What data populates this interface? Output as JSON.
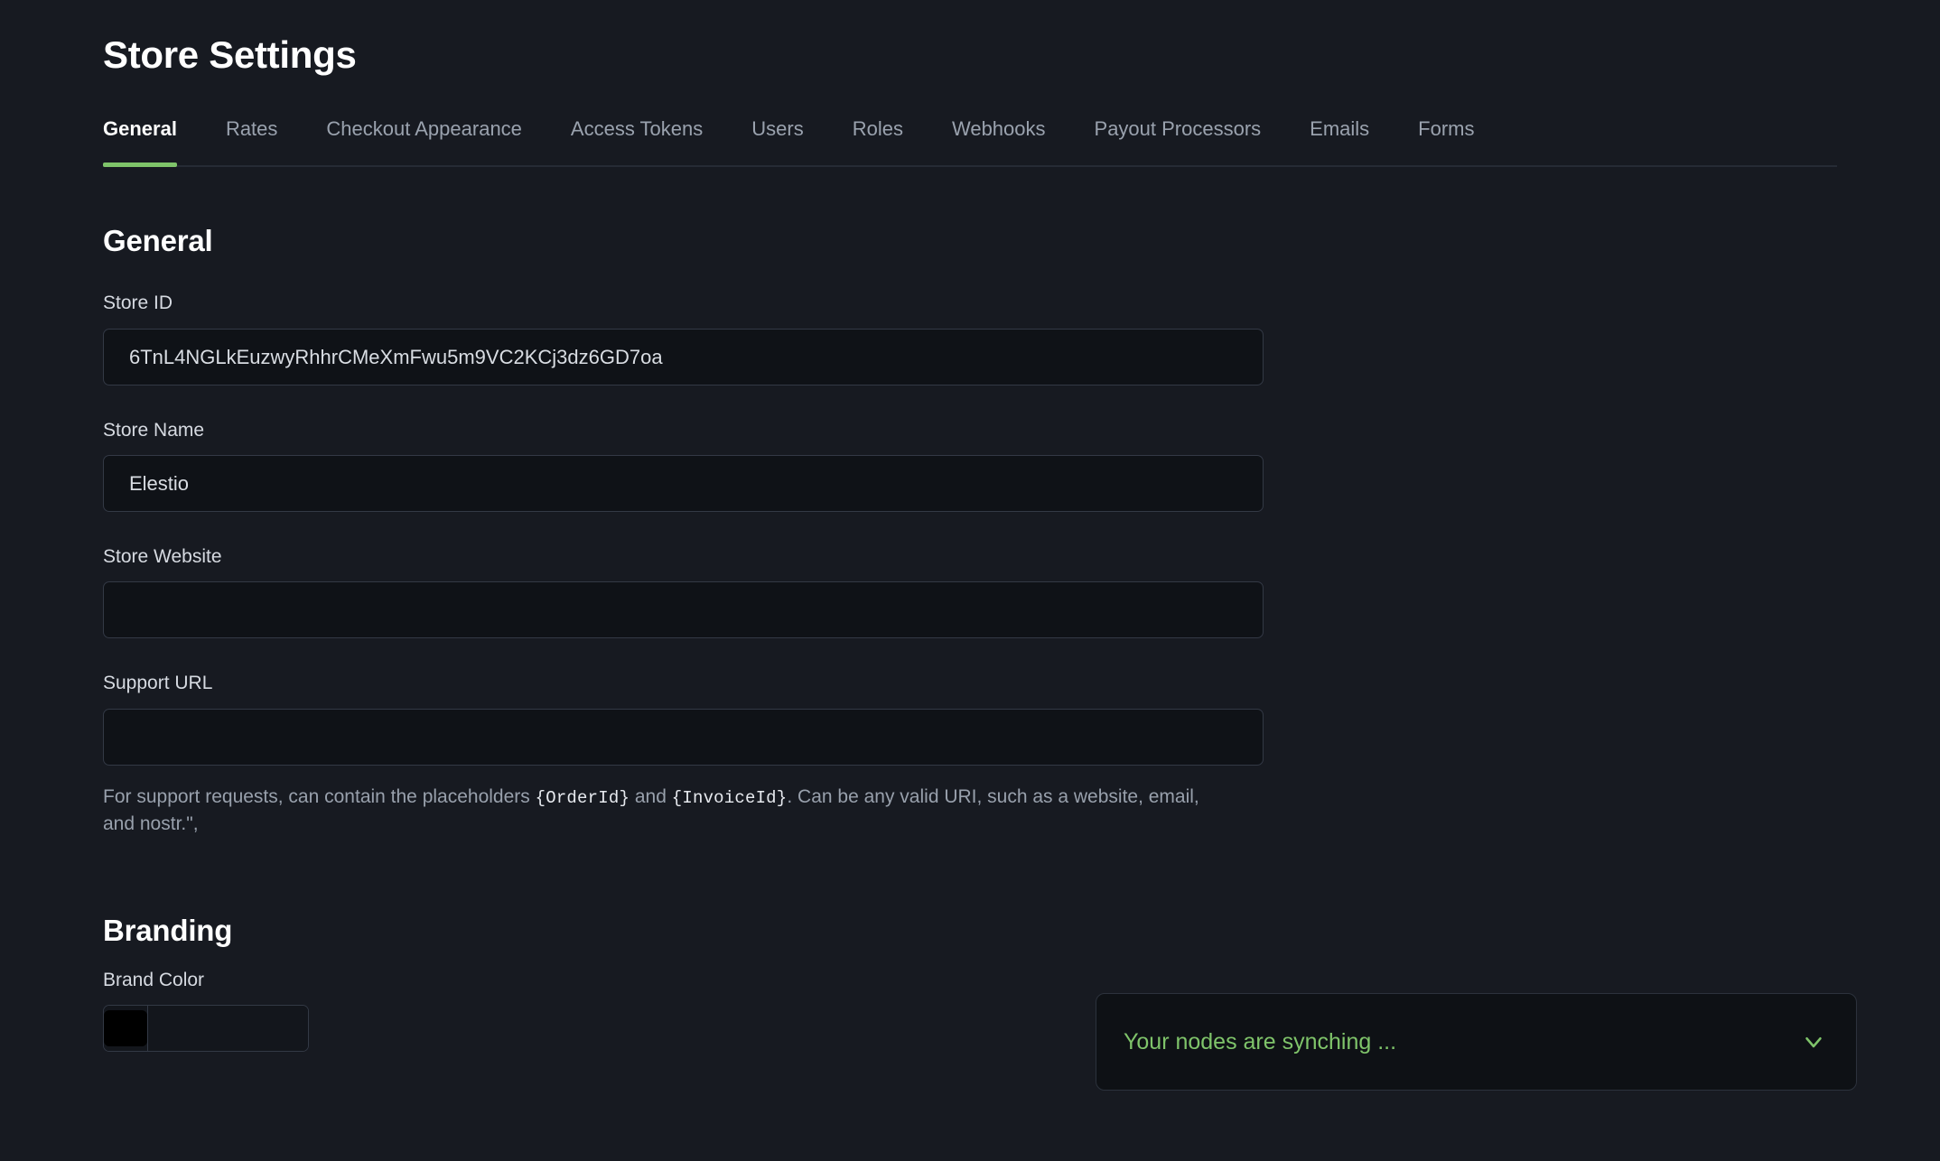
{
  "page": {
    "title": "Store Settings",
    "background_color": "#171a21",
    "accent_color": "#7fc46a"
  },
  "tabs": [
    {
      "label": "General",
      "active": true
    },
    {
      "label": "Rates",
      "active": false
    },
    {
      "label": "Checkout Appearance",
      "active": false
    },
    {
      "label": "Access Tokens",
      "active": false
    },
    {
      "label": "Users",
      "active": false
    },
    {
      "label": "Roles",
      "active": false
    },
    {
      "label": "Webhooks",
      "active": false
    },
    {
      "label": "Payout Processors",
      "active": false
    },
    {
      "label": "Emails",
      "active": false
    },
    {
      "label": "Forms",
      "active": false
    }
  ],
  "general": {
    "heading": "General",
    "store_id": {
      "label": "Store ID",
      "value": "6TnL4NGLkEuzwyRhhrCMeXmFwu5m9VC2KCj3dz6GD7oa",
      "placeholder": ""
    },
    "store_name": {
      "label": "Store Name",
      "value": "Elestio",
      "placeholder": ""
    },
    "store_website": {
      "label": "Store Website",
      "value": "",
      "placeholder": ""
    },
    "support_url": {
      "label": "Support URL",
      "value": "",
      "placeholder": "",
      "help": {
        "part1": "For support requests, can contain the placeholders ",
        "code1": "{OrderId}",
        "part2": " and ",
        "code2": "{InvoiceId}",
        "part3": ". Can be any valid URI, such as a website, email, and nostr.\","
      }
    }
  },
  "branding": {
    "heading": "Branding",
    "brand_color": {
      "label": "Brand Color",
      "swatch_color": "#000000",
      "value": "",
      "placeholder": ""
    }
  },
  "sync_banner": {
    "message": "Your nodes are synching ...",
    "icon": "chevron-down-icon",
    "text_color": "#7fc46a"
  }
}
